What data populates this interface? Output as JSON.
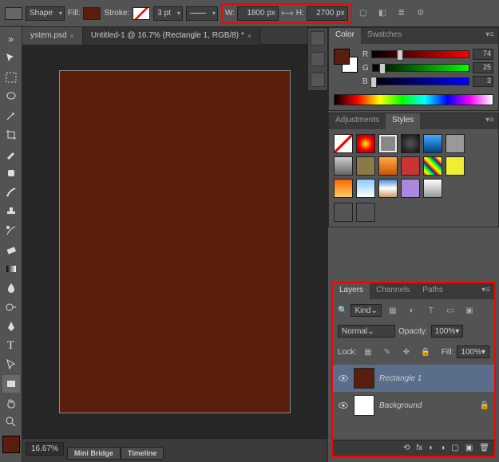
{
  "optbar": {
    "mode": "Shape",
    "fill_label": "Fill:",
    "fill_color": "#5a1e0d",
    "stroke_label": "Stroke:",
    "stroke_pt": "3 pt",
    "w_label": "W:",
    "w_value": "1800 px",
    "h_label": "H:",
    "h_value": "2700 px"
  },
  "tabs": {
    "t1": "ystem.psd",
    "t2": "Untitled-1 @ 16.7% (Rectangle 1, RGB/8) *"
  },
  "zoom": "16.67%",
  "minitabs": {
    "a": "Mini Bridge",
    "b": "Timeline"
  },
  "color": {
    "tab1": "Color",
    "tab2": "Swatches",
    "fg": "#5a1e0d",
    "r_label": "R",
    "r_val": "74",
    "g_label": "G",
    "g_val": "25",
    "b_label": "B",
    "b_val": "3"
  },
  "adj": {
    "tab1": "Adjustments",
    "tab2": "Styles"
  },
  "layers": {
    "tab1": "Layers",
    "tab2": "Channels",
    "tab3": "Paths",
    "filter": "Kind",
    "blend": "Normal",
    "opacity_label": "Opacity:",
    "opacity": "100%",
    "lock_label": "Lock:",
    "fill_label": "Fill:",
    "fill": "100%",
    "l1": "Rectangle 1",
    "l2": "Background"
  }
}
